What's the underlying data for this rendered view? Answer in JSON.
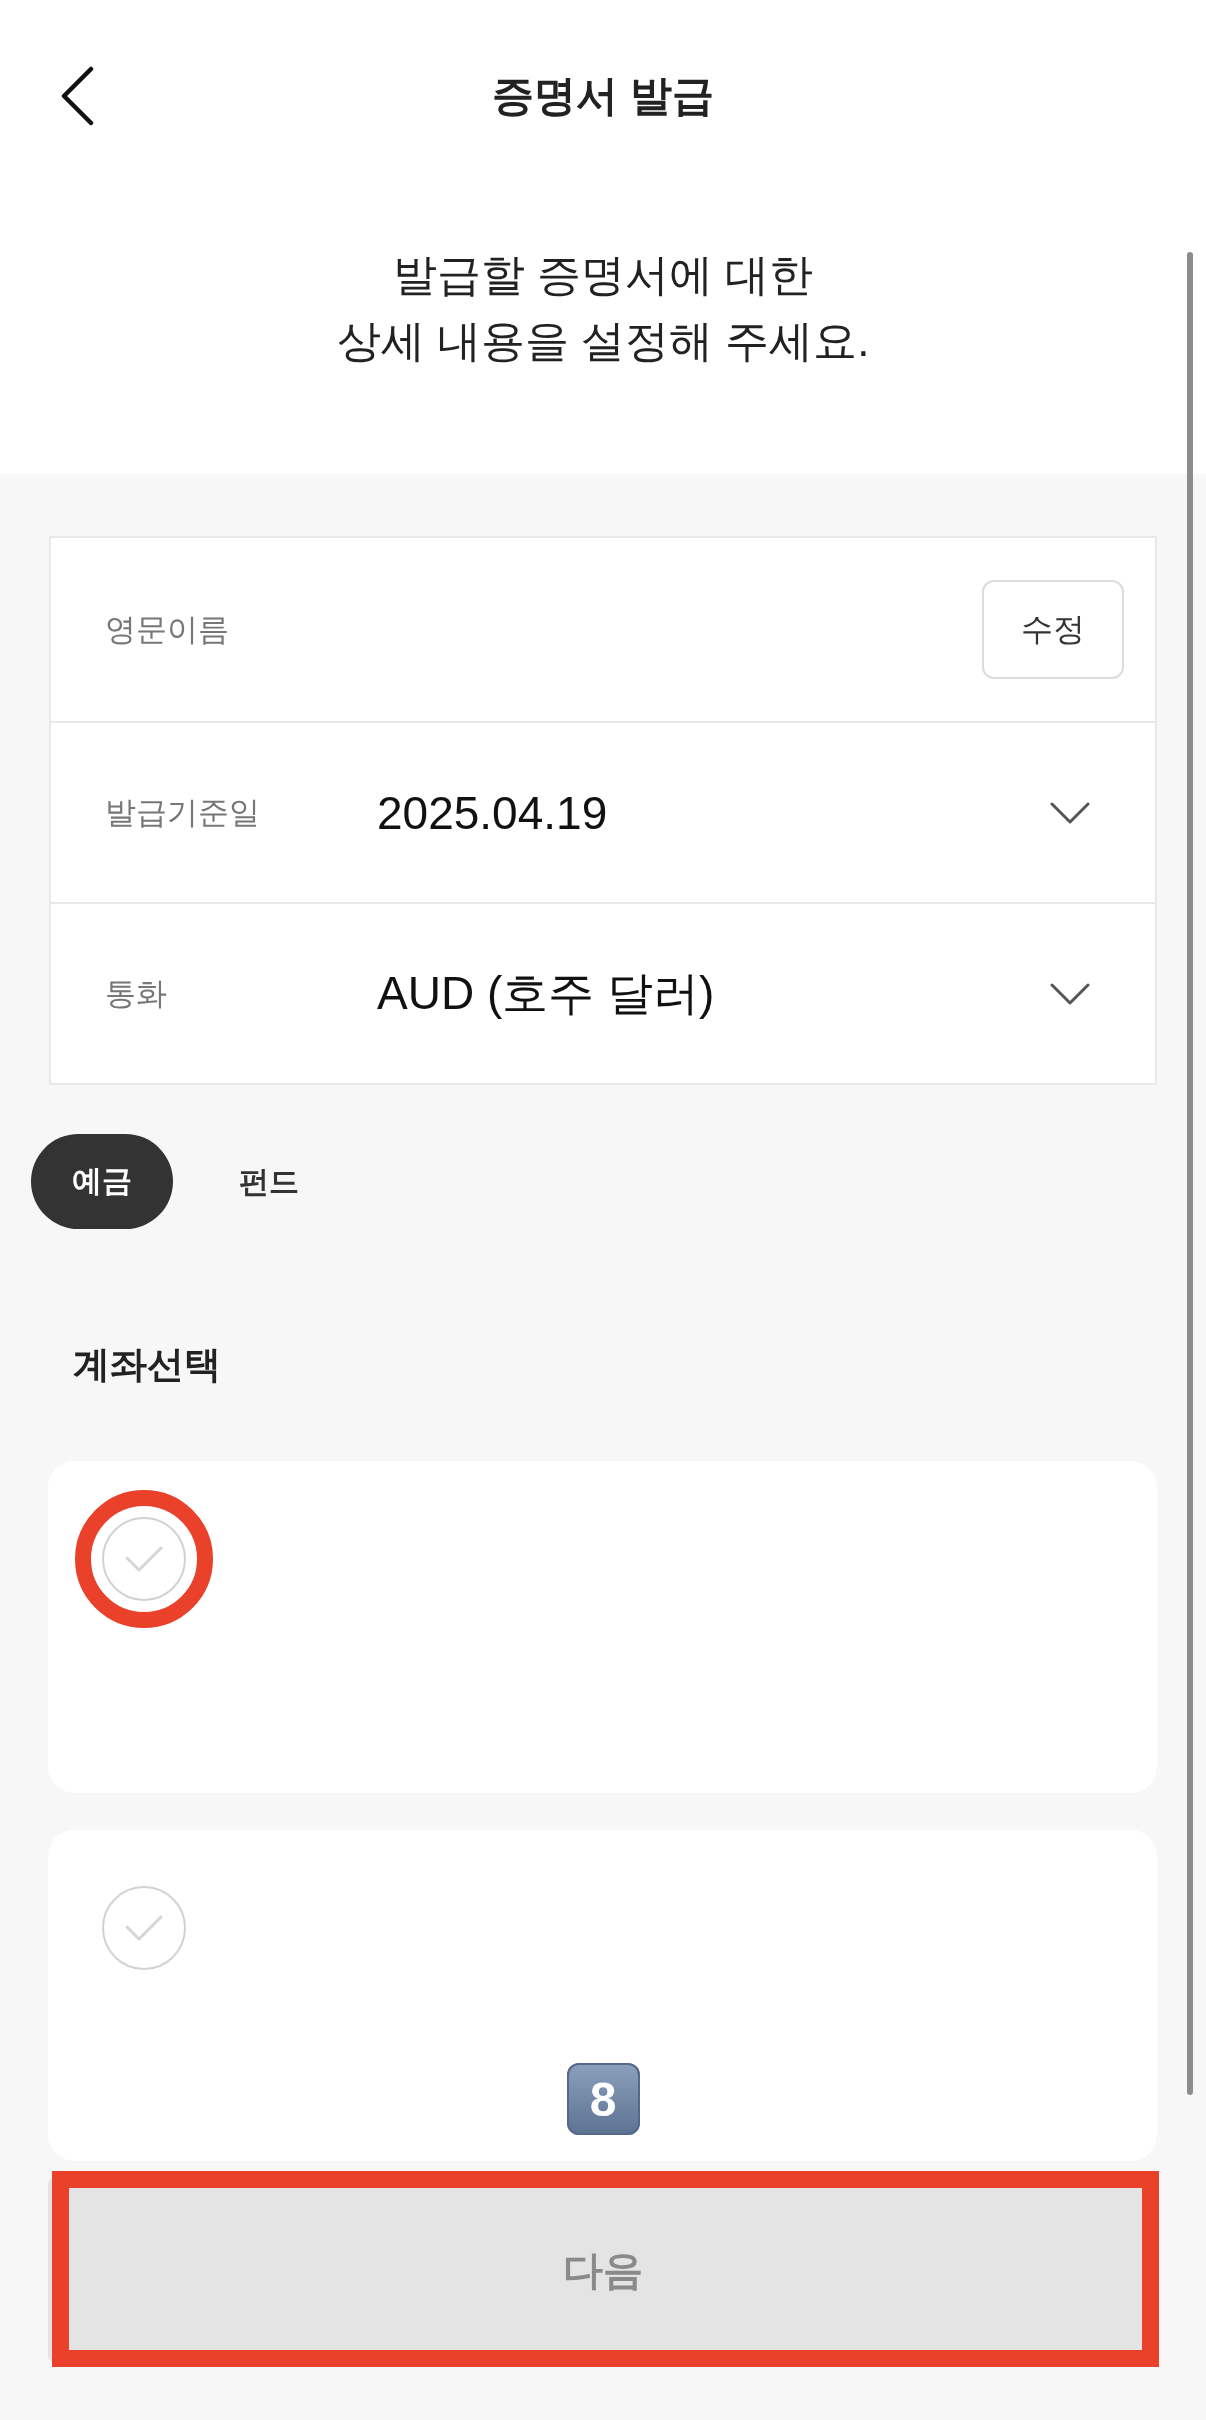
{
  "nav": {
    "title": "증명서 발급"
  },
  "intro": "발급할 증명서에 대한\n상세 내용을 설정해 주세요.",
  "form": {
    "rows": [
      {
        "kind": "text",
        "label": "영문이름",
        "button": "수정"
      },
      {
        "kind": "select",
        "label": "발급기준일",
        "value": "2025.04.19"
      },
      {
        "kind": "select",
        "label": "통화",
        "value": "AUD (호주 달러)"
      }
    ]
  },
  "tabs": [
    {
      "label": "예금",
      "selected": true
    },
    {
      "label": "펀드",
      "selected": false
    }
  ],
  "section_title": "계좌선택",
  "accounts": [
    {
      "checked": false,
      "highlighted": true
    },
    {
      "checked": false,
      "highlighted": false,
      "marker": "8"
    }
  ],
  "next_button": {
    "label": "다음",
    "disabled": true,
    "highlighted": true
  }
}
